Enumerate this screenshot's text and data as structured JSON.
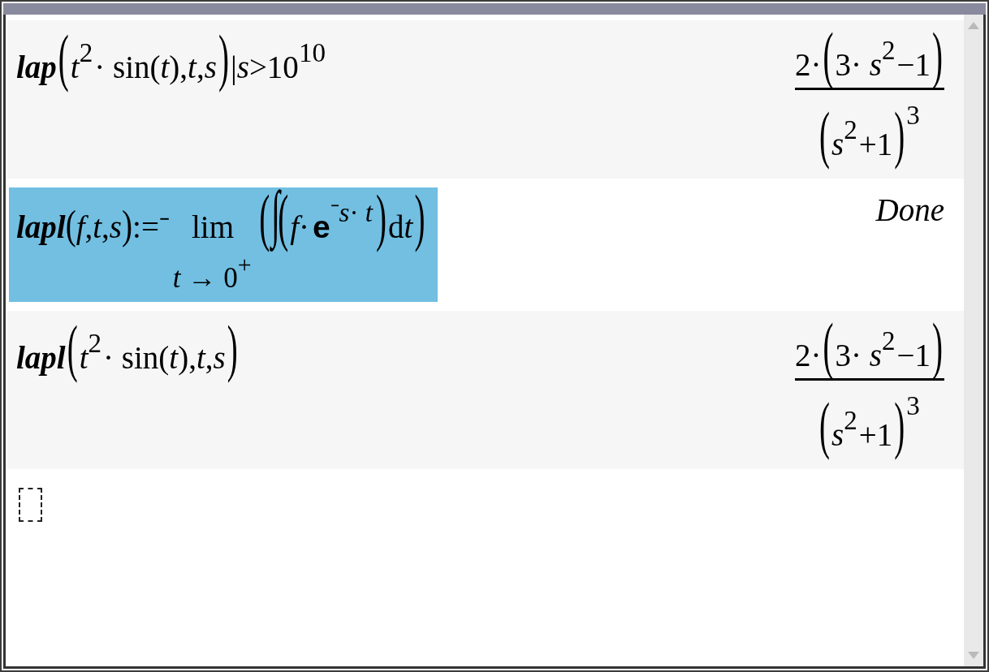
{
  "history": [
    {
      "selected": false,
      "input": [
        {
          "kind": "func",
          "text": "lap"
        },
        {
          "kind": "bigparen",
          "text": "("
        },
        {
          "kind": "text",
          "text": "*t*"
        },
        {
          "kind": "sup",
          "text": "2"
        },
        {
          "kind": "text",
          "text": "· sin(*t*),*t*,*s*"
        },
        {
          "kind": "bigparen",
          "text": ")"
        },
        {
          "kind": "text",
          "text": "|*s*>10"
        },
        {
          "kind": "sup",
          "text": "10"
        }
      ],
      "output": {
        "kind": "math",
        "tokens": [
          {
            "kind": "frac",
            "numerator": [
              {
                "kind": "text",
                "text": "2·"
              },
              {
                "kind": "bigparen",
                "text": "("
              },
              {
                "kind": "text",
                "text": "3· *s*"
              },
              {
                "kind": "sup",
                "text": "2"
              },
              {
                "kind": "text",
                "text": "−1"
              },
              {
                "kind": "bigparen",
                "text": ")"
              }
            ],
            "denominator": [
              {
                "kind": "bigparen",
                "text": "("
              },
              {
                "kind": "text",
                "text": "*s*"
              },
              {
                "kind": "sup",
                "text": "2"
              },
              {
                "kind": "text",
                "text": "+1"
              },
              {
                "kind": "bigparen",
                "text": ")"
              },
              {
                "kind": "sup",
                "text": "3"
              }
            ]
          }
        ]
      }
    },
    {
      "selected": true,
      "input": [
        {
          "kind": "func",
          "text": "lapl"
        },
        {
          "kind": "paren",
          "text": "("
        },
        {
          "kind": "text",
          "text": "*f*,*t*,*s*"
        },
        {
          "kind": "paren",
          "text": ")"
        },
        {
          "kind": "text",
          "text": ":=⁻"
        },
        {
          "kind": "limit",
          "text": "lim",
          "under": [
            {
              "kind": "text",
              "text": "*t* → 0"
            },
            {
              "kind": "sup",
              "text": "+"
            }
          ]
        },
        {
          "kind": "bigparen",
          "text": "("
        },
        {
          "kind": "integral",
          "text": "∫"
        },
        {
          "kind": "bigparen",
          "text": "("
        },
        {
          "kind": "text",
          "text": "*f*·"
        },
        {
          "kind": "constant",
          "text": "e"
        },
        {
          "kind": "sup",
          "text": "⁻*s*· *t*"
        },
        {
          "kind": "bigparen",
          "text": ")"
        },
        {
          "kind": "text",
          "text": "d"
        },
        {
          "kind": "text",
          "text": "*t*"
        },
        {
          "kind": "bigparen",
          "text": ")"
        }
      ],
      "output": {
        "kind": "message",
        "text": "Done"
      }
    },
    {
      "selected": false,
      "input": [
        {
          "kind": "func",
          "text": "lapl"
        },
        {
          "kind": "bigparen",
          "text": "("
        },
        {
          "kind": "text",
          "text": "*t*"
        },
        {
          "kind": "sup",
          "text": "2"
        },
        {
          "kind": "text",
          "text": "· sin(*t*),*t*,*s*"
        },
        {
          "kind": "bigparen",
          "text": ")"
        }
      ],
      "output": {
        "kind": "math",
        "tokens": [
          {
            "kind": "frac",
            "numerator": [
              {
                "kind": "text",
                "text": "2·"
              },
              {
                "kind": "bigparen",
                "text": "("
              },
              {
                "kind": "text",
                "text": "3· *s*"
              },
              {
                "kind": "sup",
                "text": "2"
              },
              {
                "kind": "text",
                "text": "−1"
              },
              {
                "kind": "bigparen",
                "text": ")"
              }
            ],
            "denominator": [
              {
                "kind": "bigparen",
                "text": "("
              },
              {
                "kind": "text",
                "text": "*s*"
              },
              {
                "kind": "sup",
                "text": "2"
              },
              {
                "kind": "text",
                "text": "+1"
              },
              {
                "kind": "bigparen",
                "text": ")"
              },
              {
                "kind": "sup",
                "text": "3"
              }
            ]
          }
        ]
      }
    }
  ]
}
